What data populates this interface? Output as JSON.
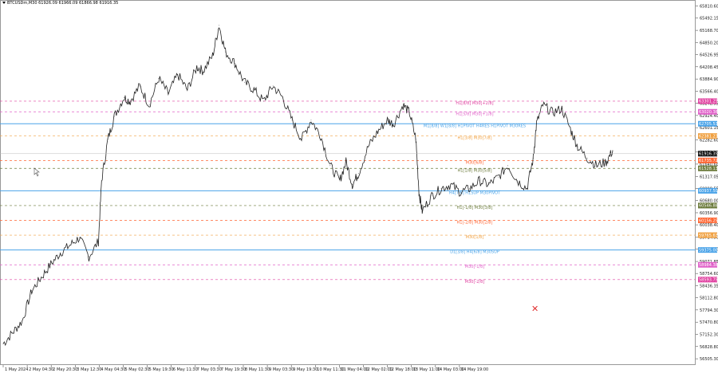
{
  "symbol_info": {
    "symbol": "BTCUSDm,M30",
    "ohlc": "61926.09 61966.09 61866.98 61916.35"
  },
  "y_axis_ticks": [
    "65810.60",
    "65492.15",
    "65168.70",
    "64850.20",
    "64526.95",
    "64208.45",
    "63884.90",
    "63566.40",
    "63242.95",
    "62924.40",
    "62601.15",
    "62282.60",
    "61959.10",
    "61640.60",
    "61317.05",
    "60998.55",
    "60680.00",
    "60356.90",
    "60038.40",
    "59714.90",
    "59396.40",
    "59071.85",
    "58754.60",
    "58436.35",
    "58112.80",
    "57794.30",
    "57470.80",
    "57152.30",
    "56828.80",
    "56505.30"
  ],
  "x_axis_ticks": [
    "1 May 2024",
    "2 May 04:30",
    "2 May 20:30",
    "3 May 12:30",
    "4 May 04:30",
    "5 May 02:30",
    "5 May 19:30",
    "6 May 11:30",
    "7 May 03:30",
    "7 May 19:30",
    "8 May 11:30",
    "9 May 03:30",
    "9 May 19:30",
    "10 May 11:30",
    "11 May 04:00",
    "12 May 02:00",
    "12 May 18:00",
    "13 May 11:00",
    "14 May 03:00",
    "14 May 19:00"
  ],
  "levels": [
    {
      "label": "H1[8/8] M30[+2/8]",
      "price_tag": "63301.25",
      "color": "#e040a0",
      "style": "dash"
    },
    {
      "label": "H1[5/8] M30[+1/8]",
      "price_tag": "63020.36",
      "color": "#e060c8",
      "style": "dash"
    },
    {
      "label": "M1[8/8] W1[8/8] H1PIVOT H4RES H1PIVOT M30RES",
      "price_tag": "62705.53",
      "color": "#4aa3e8",
      "style": "solid"
    },
    {
      "label": "H1[3/8] M30[7/8]",
      "price_tag": "62381.23",
      "color": "#f0a040",
      "style": "dash"
    },
    {
      "label": "M30[6/8]",
      "price_tag": "61735.72",
      "color": "#ff6633",
      "style": "dash"
    },
    {
      "label": "H1[1/8] M30[5/8]",
      "price_tag": "61528.13",
      "color": "#6b7a3a",
      "style": "dash"
    },
    {
      "label": "H4[7/8] H1SUP M30PIVOT",
      "price_tag": "60937.50",
      "color": "#4aa3e8",
      "style": "solid"
    },
    {
      "label": "H1[-1/8] M30[3/8]",
      "price_tag": "60546.88",
      "color": "#6b7a3a",
      "style": "dash"
    },
    {
      "label": "H1[-2/8] M30[2/8]",
      "price_tag": "60156.25",
      "color": "#ff6633",
      "style": "dash"
    },
    {
      "label": "M30[1/8]",
      "price_tag": "59765.63",
      "color": "#f0a040",
      "style": "dash"
    },
    {
      "label": "D1[3/8] H4[6/8] M30SUP",
      "price_tag": "59375.00",
      "color": "#4aa3e8",
      "style": "solid"
    },
    {
      "label": "M30[-1/8]",
      "price_tag": "58984.38",
      "color": "#e060c8",
      "style": "dash"
    },
    {
      "label": "M30[-2/8]",
      "price_tag": "58593.75",
      "color": "#e040a0",
      "style": "dash"
    }
  ],
  "current_price": {
    "label": "61916.35",
    "color": "#111111"
  },
  "chart_data": {
    "type": "line",
    "title": "BTCUSDm,M30",
    "xlabel": "",
    "ylabel": "",
    "ylim": [
      56340,
      65970
    ],
    "x": [
      "1 May 2024",
      "2 May 04:30",
      "2 May 20:30",
      "3 May 12:30",
      "4 May 04:30",
      "5 May 02:30",
      "5 May 19:30",
      "6 May 11:30",
      "7 May 03:30",
      "7 May 19:30",
      "8 May 11:30",
      "9 May 03:30",
      "9 May 19:30",
      "10 May 11:30",
      "11 May 04:00",
      "12 May 02:00",
      "12 May 18:00",
      "13 May 11:00",
      "14 May 03:00",
      "14 May 19:00"
    ],
    "series": [
      {
        "values": [
          [
            0,
            56900
          ],
          [
            0.3,
            57200
          ],
          [
            0.6,
            57500
          ],
          [
            0.9,
            58300
          ],
          [
            1.2,
            58650
          ],
          [
            1.5,
            59000
          ],
          [
            1.8,
            59300
          ],
          [
            2.1,
            59500
          ],
          [
            2.4,
            59700
          ],
          [
            2.7,
            59200
          ],
          [
            3.0,
            59600
          ],
          [
            3.1,
            61200
          ],
          [
            3.3,
            62300
          ],
          [
            3.5,
            62900
          ],
          [
            3.8,
            63400
          ],
          [
            4.0,
            63300
          ],
          [
            4.3,
            63700
          ],
          [
            4.6,
            63200
          ],
          [
            4.9,
            63900
          ],
          [
            5.2,
            63500
          ],
          [
            5.5,
            64000
          ],
          [
            5.8,
            63600
          ],
          [
            6.1,
            64200
          ],
          [
            6.3,
            64100
          ],
          [
            6.6,
            64500
          ],
          [
            6.8,
            65300
          ],
          [
            7.0,
            64600
          ],
          [
            7.3,
            64300
          ],
          [
            7.6,
            63800
          ],
          [
            7.9,
            63600
          ],
          [
            8.2,
            63300
          ],
          [
            8.5,
            63700
          ],
          [
            8.8,
            63400
          ],
          [
            9.1,
            62800
          ],
          [
            9.4,
            62300
          ],
          [
            9.7,
            62800
          ],
          [
            10.0,
            62400
          ],
          [
            10.3,
            61600
          ],
          [
            10.6,
            61200
          ],
          [
            10.8,
            61700
          ],
          [
            11.0,
            61100
          ],
          [
            11.2,
            61400
          ],
          [
            11.5,
            62100
          ],
          [
            11.8,
            62500
          ],
          [
            12.1,
            62800
          ],
          [
            12.3,
            62700
          ],
          [
            12.6,
            63200
          ],
          [
            12.8,
            63000
          ],
          [
            13.0,
            62300
          ],
          [
            13.1,
            60900
          ],
          [
            13.2,
            60400
          ],
          [
            13.5,
            60800
          ],
          [
            13.8,
            61000
          ],
          [
            14.1,
            61100
          ],
          [
            14.4,
            60900
          ],
          [
            14.7,
            61000
          ],
          [
            15.0,
            61200
          ],
          [
            15.3,
            61100
          ],
          [
            15.6,
            61300
          ],
          [
            15.9,
            61600
          ],
          [
            16.2,
            61200
          ],
          [
            16.5,
            61000
          ],
          [
            16.7,
            61800
          ],
          [
            16.8,
            62700
          ],
          [
            17.0,
            63200
          ],
          [
            17.3,
            63000
          ],
          [
            17.6,
            63100
          ],
          [
            17.9,
            62500
          ],
          [
            18.1,
            62100
          ],
          [
            18.4,
            61800
          ],
          [
            18.7,
            61600
          ],
          [
            19.0,
            61700
          ],
          [
            19.2,
            62000
          ]
        ]
      }
    ]
  }
}
